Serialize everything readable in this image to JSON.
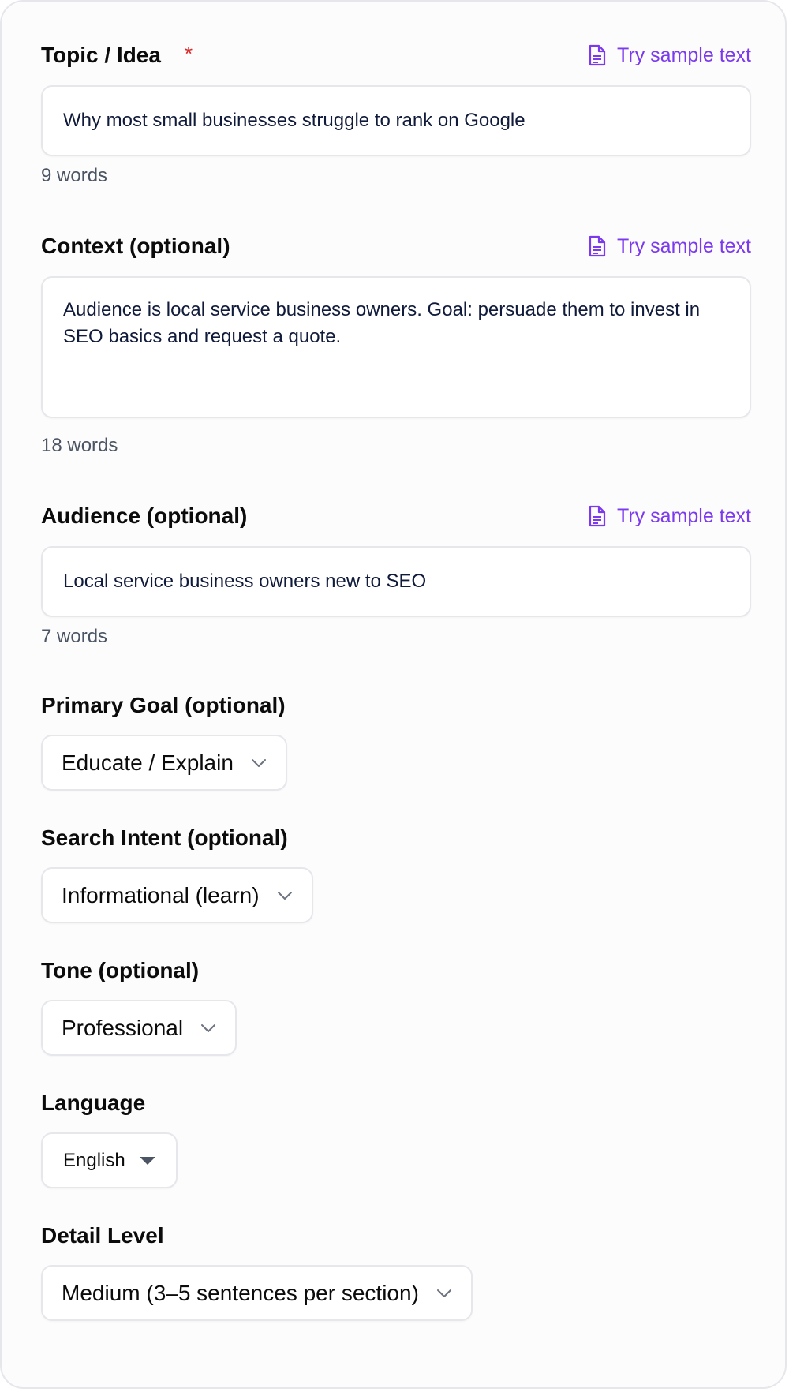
{
  "sample_link_label": "Try sample text",
  "topic": {
    "label": "Topic / Idea",
    "required_marker": "*",
    "value": "Why most small businesses struggle to rank on Google",
    "word_count": "9 words"
  },
  "context": {
    "label": "Context (optional)",
    "value": "Audience is local service business owners. Goal: persuade them to invest in SEO basics and request a quote.",
    "word_count": "18 words"
  },
  "audience": {
    "label": "Audience (optional)",
    "value": "Local service business owners new to SEO",
    "word_count": "7 words"
  },
  "primary_goal": {
    "label": "Primary Goal (optional)",
    "selected": "Educate / Explain"
  },
  "search_intent": {
    "label": "Search Intent (optional)",
    "selected": "Informational (learn)"
  },
  "tone": {
    "label": "Tone (optional)",
    "selected": "Professional"
  },
  "language": {
    "label": "Language",
    "selected": "English"
  },
  "detail_level": {
    "label": "Detail Level",
    "selected": "Medium (3–5 sentences per section)"
  },
  "colors": {
    "accent": "#7c3aed",
    "required": "#dc2626",
    "border": "#e5e7eb"
  },
  "icons": {
    "sample": "document-icon",
    "dropdown": "chevron-down-icon",
    "language_dropdown": "caret-down-icon"
  }
}
